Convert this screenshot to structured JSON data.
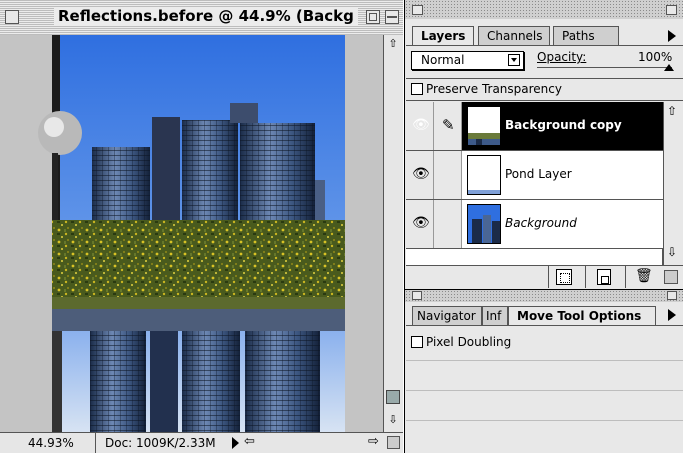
{
  "document": {
    "title": "Reflections.before @ 44.9%  (Backg",
    "zoom_value": "44.93%",
    "doc_size": "Doc: 1009K/2.33M"
  },
  "layers_palette": {
    "tabs": [
      "Layers",
      "Channels",
      "Paths"
    ],
    "blend_mode": "Normal",
    "opacity_label": "Opacity:",
    "opacity_value": "100%",
    "preserve_transparency_label": "Preserve Transparency",
    "layers": [
      {
        "name": "Background copy",
        "selected": true
      },
      {
        "name": "Pond Layer",
        "selected": false
      },
      {
        "name": "Background",
        "selected": false
      }
    ]
  },
  "options_palette": {
    "tabs": [
      "Navigator",
      "Inf",
      "Move Tool Options"
    ],
    "pixel_doubling_label": "Pixel Doubling"
  },
  "colors": {
    "sky": "#2f6ad8",
    "selected_row": "#000000",
    "chrome": "#e8e8e8"
  }
}
